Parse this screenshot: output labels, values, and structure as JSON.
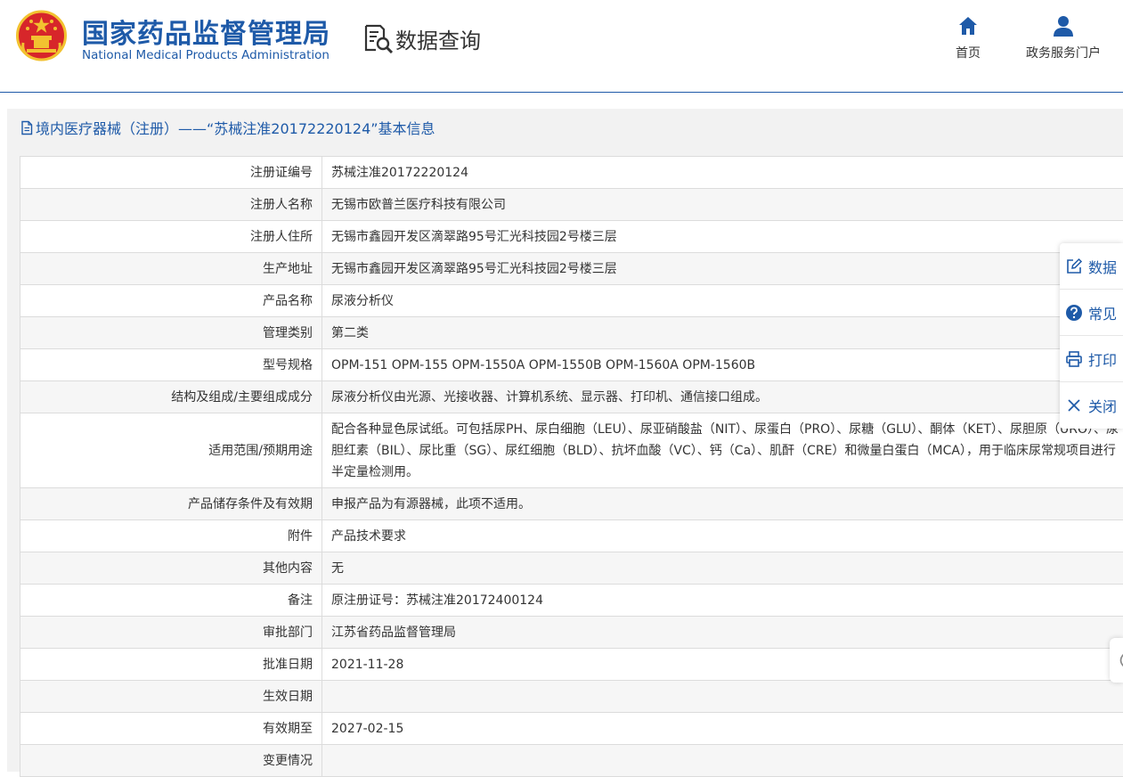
{
  "header": {
    "title_cn": "国家药品监督管理局",
    "title_en": "National Medical Products Administration",
    "query_label": "数据查询",
    "nav": [
      {
        "label": "首页",
        "icon": "home-icon"
      },
      {
        "label": "政务服务门户",
        "icon": "user-icon"
      }
    ]
  },
  "panel": {
    "title": "境内医疗器械（注册）——“苏械注准20172220124”基本信息"
  },
  "table": {
    "rows": [
      {
        "label": "注册证编号",
        "value": "苏械注准20172220124"
      },
      {
        "label": "注册人名称",
        "value": "无锡市欧普兰医疗科技有限公司"
      },
      {
        "label": "注册人住所",
        "value": "无锡市鑫园开发区滴翠路95号汇光科技园2号楼三层"
      },
      {
        "label": "生产地址",
        "value": "无锡市鑫园开发区滴翠路95号汇光科技园2号楼三层"
      },
      {
        "label": "产品名称",
        "value": "尿液分析仪"
      },
      {
        "label": "管理类别",
        "value": "第二类"
      },
      {
        "label": "型号规格",
        "value": "OPM-151 OPM-155 OPM-1550A OPM-1550B OPM-1560A OPM-1560B"
      },
      {
        "label": "结构及组成/主要组成成分",
        "value": "尿液分析仪由光源、光接收器、计算机系统、显示器、打印机、通信接口组成。"
      },
      {
        "label": "适用范围/预期用途",
        "value": "配合各种显色尿试纸。可包括尿PH、尿白细胞（LEU）、尿亚硝酸盐（NIT）、尿蛋白（PRO）、尿糖（GLU）、酮体（KET）、尿胆原（URO）、尿胆红素（BIL）、尿比重（SG）、尿红细胞（BLD）、抗坏血酸（VC）、钙（Ca）、肌酐（CRE）和微量白蛋白（MCA），用于临床尿常规项目进行半定量检测用。"
      },
      {
        "label": "产品储存条件及有效期",
        "value": "申报产品为有源器械，此项不适用。"
      },
      {
        "label": "附件",
        "value": "产品技术要求"
      },
      {
        "label": "其他内容",
        "value": "无"
      },
      {
        "label": "备注",
        "value": "原注册证号：苏械注准20172400124"
      },
      {
        "label": "审批部门",
        "value": "江苏省药品监督管理局"
      },
      {
        "label": "批准日期",
        "value": "2021-11-28"
      },
      {
        "label": "生效日期",
        "value": ""
      },
      {
        "label": "有效期至",
        "value": "2027-02-15"
      },
      {
        "label": "变更情况",
        "value": ""
      }
    ]
  },
  "side_toolbar": {
    "items": [
      {
        "label": "数据",
        "icon": "edit-icon"
      },
      {
        "label": "常见",
        "icon": "question-icon"
      },
      {
        "label": "打印",
        "icon": "printer-icon"
      },
      {
        "label": "关闭",
        "icon": "close-icon"
      }
    ]
  },
  "colors": {
    "brand_blue": "#1e5aa8",
    "emblem_red": "#d7262a",
    "emblem_gold": "#f2c230"
  }
}
